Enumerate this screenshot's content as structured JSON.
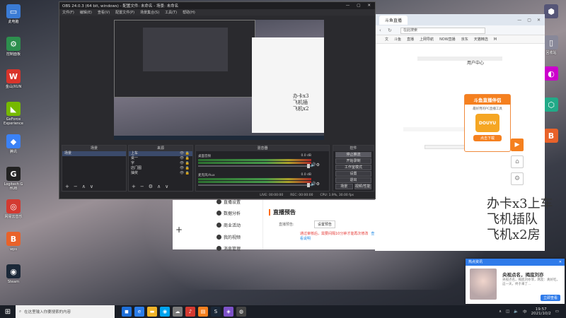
{
  "desktop": {
    "left_icons": [
      {
        "label": "此电脑",
        "glyph": "▭",
        "color": "#3a7bd5"
      },
      {
        "label": "控制面板",
        "glyph": "⚙",
        "color": "#2d8f4e"
      },
      {
        "label": "金山/XUN",
        "glyph": "W",
        "color": "#d9342b"
      },
      {
        "label": "GeForce Experience",
        "glyph": "◣",
        "color": "#76b900"
      },
      {
        "label": "腾讯",
        "glyph": "◆",
        "color": "#3b82f6"
      },
      {
        "label": "Logitech G HUB",
        "glyph": "G",
        "color": "#222"
      },
      {
        "label": "网易云音乐",
        "glyph": "◎",
        "color": "#d33a31"
      },
      {
        "label": "wps",
        "glyph": "B",
        "color": "#e8622a"
      },
      {
        "label": "Steam",
        "glyph": "◉",
        "color": "#1b2838"
      }
    ],
    "right_icons": [
      {
        "label": "",
        "glyph": "⬢",
        "color": "#557"
      },
      {
        "label": "回收站",
        "glyph": "▯",
        "color": "#889"
      },
      {
        "label": "",
        "glyph": "◐",
        "color": "#c0c"
      },
      {
        "label": "",
        "glyph": "⬡",
        "color": "#2a8"
      },
      {
        "label": "",
        "glyph": "B",
        "color": "#e8622a"
      }
    ]
  },
  "obs": {
    "title": "OBS 24.0.3 (64 bit, windows) - 配置文件: 未命名 - 场景: 未命名",
    "menu": [
      "文件(F)",
      "编辑(E)",
      "查看(V)",
      "配置文件(P)",
      "场景集合(S)",
      "工具(T)",
      "帮助(H)"
    ],
    "preview_text": [
      "办卡x3",
      "飞机插",
      "飞机x2"
    ],
    "scenes": {
      "header": "场景",
      "items": [
        "场景"
      ]
    },
    "sources": {
      "header": "来源",
      "items": [
        "上车",
        "桌一",
        "字",
        "店门图",
        "抽奖"
      ]
    },
    "mixer": {
      "header": "混音器",
      "tracks": [
        {
          "name": "桌面音频",
          "db": "0.0 dB"
        },
        {
          "name": "麦克风/Aux",
          "db": "0.0 dB"
        }
      ]
    },
    "controls": {
      "header": "控件",
      "buttons": [
        "停止推流",
        "开始录制",
        "工作室模式",
        "设置",
        "退出"
      ],
      "bottom": [
        "场景",
        "视频/性能"
      ]
    },
    "status": {
      "live": "LIVE: 00:00:00",
      "rec": "REC: 00:00:00",
      "cpu": "CPU: 1.9%, 30.00 fps"
    }
  },
  "browser": {
    "tab_title": "斗鱼直播",
    "address": "在此搜索",
    "bookmarks": [
      "文",
      "斗鱼",
      "直播",
      "上网导航",
      "NOW直播",
      "京东",
      "天猫精选",
      "M"
    ],
    "sidebar_user": "用户中心",
    "ad": {
      "title": "斗鱼直播伴侣",
      "desc": "最好用的PC直播工具",
      "logo": "DOUYU",
      "button": "点击下载"
    },
    "overlay_text": [
      "办卡x3上车",
      "飞机插队",
      "飞机x2房"
    ]
  },
  "live_settings": {
    "menu": [
      "直播设置",
      "数据分析",
      "商业活动",
      "我的视频",
      "消息管理"
    ],
    "title": "直播预告",
    "option_label": "直播预告:",
    "option_btn": "设置预告",
    "warning": "通过审核后，需要间隔10分钟才能再次修改",
    "warning_link": "查看说明"
  },
  "notification": {
    "header": "热点资讯",
    "title": "央视点名，揭底刘亦",
    "body": "央视点名，揭底刘亦菲，网友：真好吃，这一天，终于来了…",
    "button": "立即查看"
  },
  "taskbar": {
    "search_placeholder": "在这里输入你要搜索的内容",
    "time": "19:57",
    "date": "2021/10/2",
    "apps": [
      {
        "glyph": "◼",
        "color": "#1e6fd9"
      },
      {
        "glyph": "e",
        "color": "#2b7de9"
      },
      {
        "glyph": "▬",
        "color": "#f0b429"
      },
      {
        "glyph": "◉",
        "color": "#00a4ef"
      },
      {
        "glyph": "☁",
        "color": "#7a7a7a"
      },
      {
        "glyph": "♪",
        "color": "#d33a31"
      },
      {
        "glyph": "▤",
        "color": "#f5801f"
      },
      {
        "glyph": "S",
        "color": "#1b2838"
      },
      {
        "glyph": "◈",
        "color": "#7d52c8"
      },
      {
        "glyph": "◍",
        "color": "#444"
      }
    ]
  }
}
